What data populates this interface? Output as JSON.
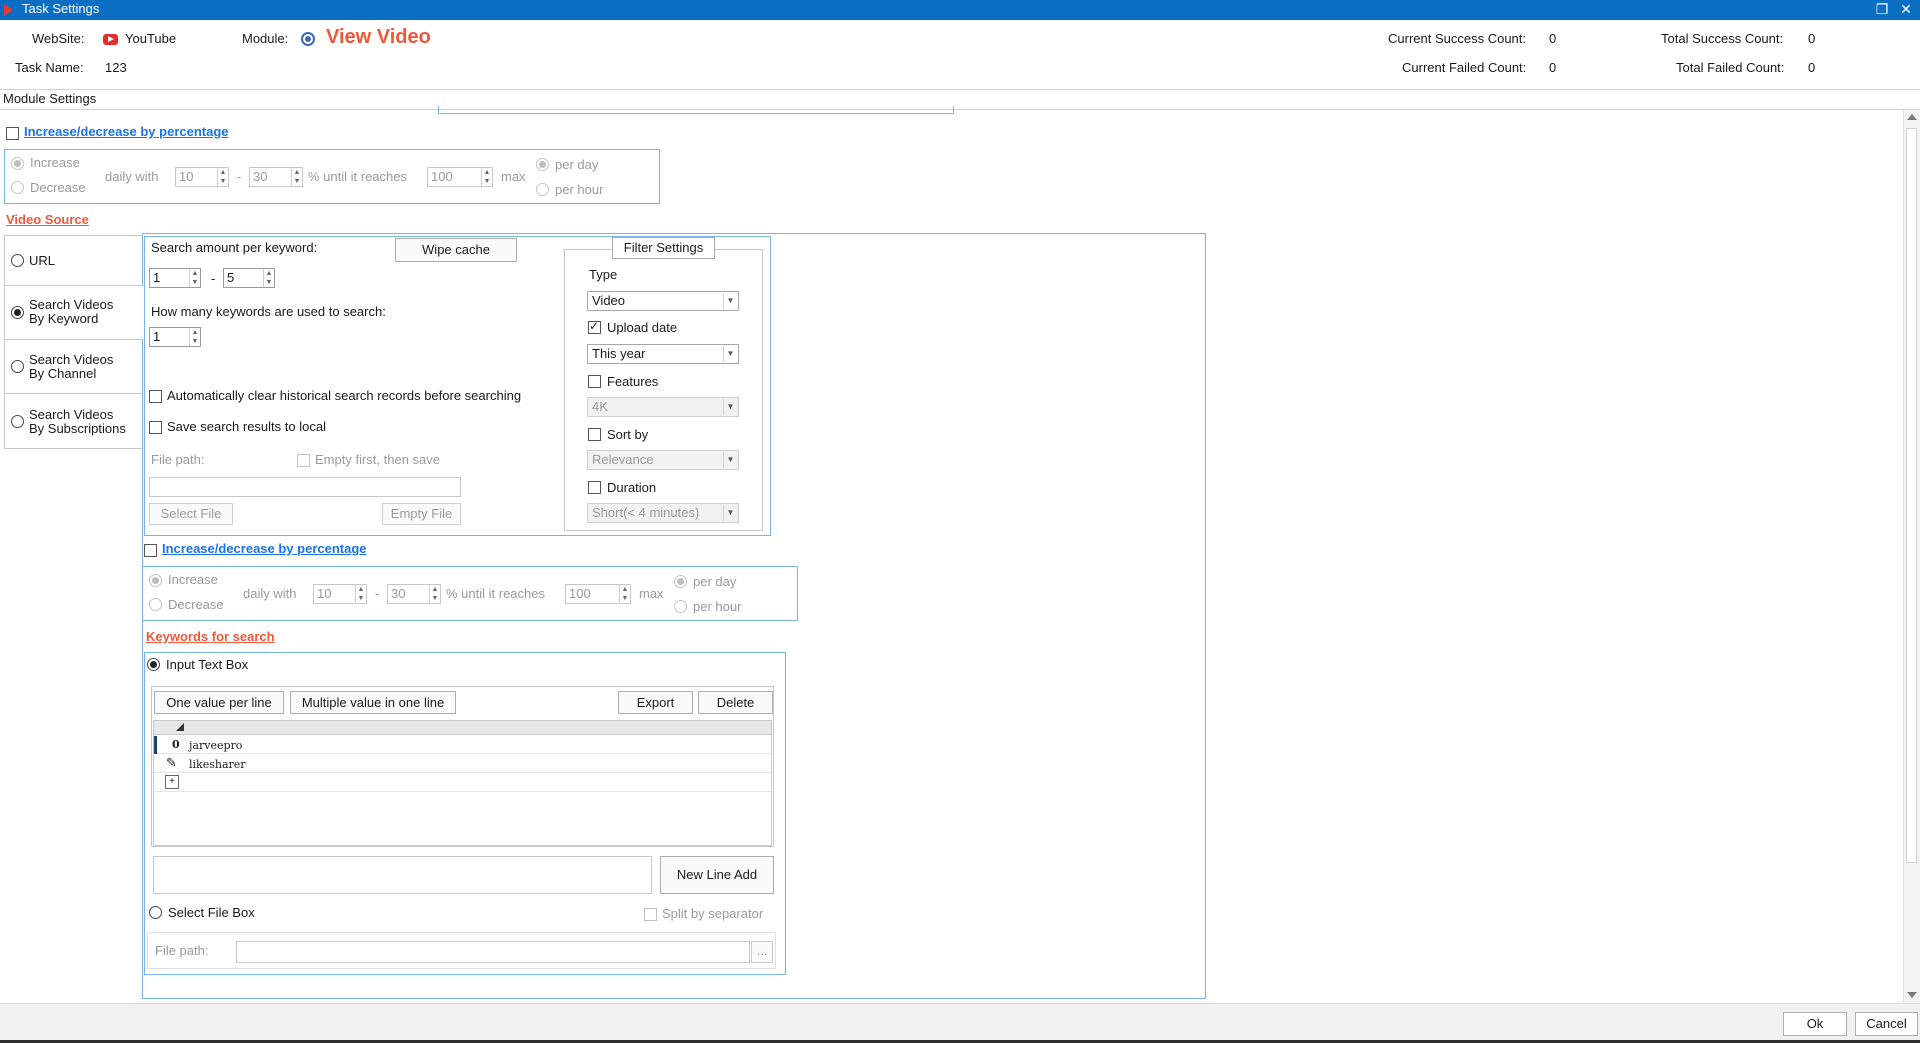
{
  "window": {
    "title": "Task Settings"
  },
  "header": {
    "website_label": "WebSite:",
    "website_value": "YouTube",
    "module_label": "Module:",
    "module_value": "View Video",
    "task_name_label": "Task Name:",
    "task_name_value": "123",
    "current_success_label": "Current Success Count:",
    "current_success_value": "0",
    "total_success_label": "Total Success Count:",
    "total_success_value": "0",
    "current_failed_label": "Current Failed Count:",
    "current_failed_value": "0",
    "total_failed_label": "Total Failed Count:",
    "total_failed_value": "0"
  },
  "module_settings_label": "Module Settings",
  "pct_top": {
    "title": "Increase/decrease by percentage",
    "increase": "Increase",
    "decrease": "Decrease",
    "daily_with": "daily with",
    "from": "10",
    "dash": "-",
    "to": "30",
    "until": "% until it reaches",
    "max_value": "100",
    "max": "max",
    "per_day": "per day",
    "per_hour": "per hour"
  },
  "video_source": {
    "title": "Video Source",
    "tabs": [
      {
        "line1": "URL",
        "line2": ""
      },
      {
        "line1": "Search Videos",
        "line2": "By Keyword"
      },
      {
        "line1": "Search Videos",
        "line2": "By Channel"
      },
      {
        "line1": "Search Videos",
        "line2": "By Subscriptions"
      }
    ]
  },
  "search": {
    "amount_label": "Search amount per keyword:",
    "amount_from": "1",
    "dash": "-",
    "amount_to": "5",
    "wipe_cache": "Wipe cache",
    "keywords_used_label": "How many keywords are used to search:",
    "keywords_used": "1",
    "auto_clear": "Automatically clear historical search records before searching",
    "save_local": "Save search results to local",
    "file_path_label": "File path:",
    "empty_first": "Empty first, then save",
    "select_file": "Select File",
    "empty_file": "Empty File"
  },
  "filter": {
    "title": "Filter Settings",
    "type_label": "Type",
    "type_value": "Video",
    "upload_date_label": "Upload date",
    "upload_date_value": "This year",
    "features_label": "Features",
    "features_value": "4K",
    "sort_label": "Sort by",
    "sort_value": "Relevance",
    "duration_label": "Duration",
    "duration_value": "Short(< 4 minutes)"
  },
  "pct_mid": {
    "title": "Increase/decrease by percentage",
    "increase": "Increase",
    "decrease": "Decrease",
    "daily_with": "daily with",
    "from": "10",
    "dash": "-",
    "to": "30",
    "until": "% until it reaches",
    "max_value": "100",
    "max": "max",
    "per_day": "per day",
    "per_hour": "per hour"
  },
  "keywords": {
    "title": "Keywords for search",
    "input_text_box": "Input Text Box",
    "one_per_line": "One value per line",
    "multi_in_line": "Multiple value in one line",
    "export": "Export",
    "delete": "Delete",
    "rows": [
      {
        "marker": "0",
        "value": "jarveepro"
      },
      {
        "marker": "",
        "value": "likesharer"
      }
    ],
    "new_line_add": "New Line Add",
    "select_file_box": "Select File Box",
    "split_sep": "Split by separator",
    "file_path_label": "File path:",
    "browse": "..."
  },
  "footer": {
    "ok": "Ok",
    "cancel": "Cancel"
  }
}
